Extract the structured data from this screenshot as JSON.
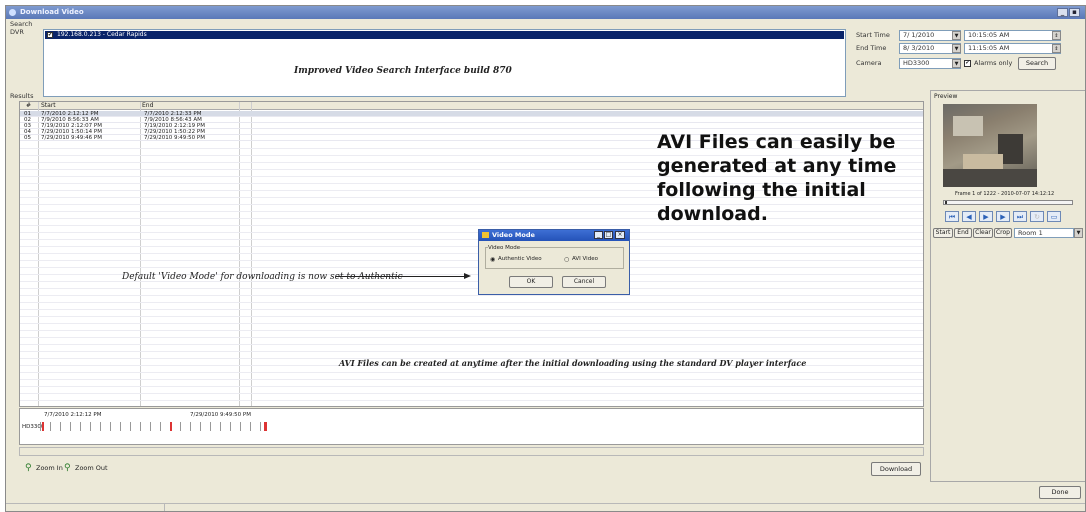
{
  "window": {
    "title": "Download Video"
  },
  "search": {
    "group_label": "Search",
    "dvr_label": "DVR",
    "dvr_item": "192.168.0.213 - Cedar Rapids",
    "banner": "Improved Video Search Interface build 870",
    "start_time_label": "Start Time",
    "start_date": "7/ 1/2010",
    "start_clock": "10:15:05 AM",
    "end_time_label": "End Time",
    "end_date": "8/ 3/2010",
    "end_clock": "11:15:05 AM",
    "camera_label": "Camera",
    "camera_value": "HD3300",
    "alarms_only_label": "Alarms only",
    "search_button": "Search"
  },
  "results": {
    "group_label": "Results",
    "columns": [
      "#",
      "Start",
      "End"
    ],
    "rows": [
      {
        "num": "01",
        "start": "7/7/2010 2:12:12 PM",
        "end": "7/7/2010 2:12:33 PM"
      },
      {
        "num": "02",
        "start": "7/9/2010 8:56:33 AM",
        "end": "7/9/2010 8:56:43 AM"
      },
      {
        "num": "03",
        "start": "7/19/2010 2:12:07 PM",
        "end": "7/19/2010 2:12:19 PM"
      },
      {
        "num": "04",
        "start": "7/29/2010 1:50:14 PM",
        "end": "7/29/2010 1:50:22 PM"
      },
      {
        "num": "05",
        "start": "7/29/2010 9:49:46 PM",
        "end": "7/29/2010 9:49:50 PM"
      }
    ]
  },
  "annotations": {
    "avi_big": "AVI Files can easily be generated at any time following the initial download.",
    "default_mode": "Default 'Video Mode' for downloading is now set to Authentic",
    "avi_footer": "AVI Files can be created at anytime after the initial downloading using the standard DV player interface"
  },
  "dialog": {
    "title": "Video Mode",
    "group_label": "Video Mode",
    "option_authentic": "Authentic Video",
    "option_avi": "AVI Video",
    "ok": "OK",
    "cancel": "Cancel"
  },
  "timeline": {
    "camera": "HD3300",
    "start_label": "7/7/2010 2:12:12 PM",
    "end_label": "7/29/2010 9:49:50 PM"
  },
  "toolbar": {
    "zoom_in": "Zoom In",
    "zoom_out": "Zoom Out",
    "download": "Download"
  },
  "preview": {
    "group_label": "Preview",
    "frame_label": "Frame 1 of 1222 - 2010-07-07 14:12:12",
    "start": "Start",
    "end": "End",
    "clear": "Clear",
    "crop": "Crop",
    "room_value": "Room 1"
  },
  "footer": {
    "done": "Done"
  },
  "colors": {
    "selection": "#0a246a",
    "accent": "#2b61b7"
  }
}
